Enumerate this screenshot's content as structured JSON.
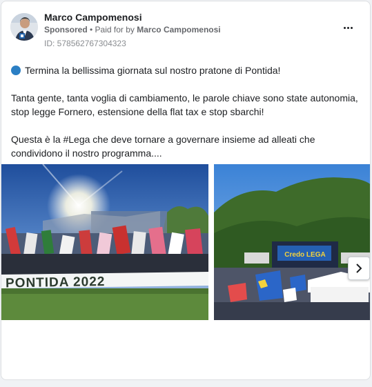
{
  "ad": {
    "advertiser_name": "Marco Campomenosi",
    "sponsored_label": "Sponsored",
    "paid_for_prefix": "• Paid for by",
    "paid_for_by": "Marco Campomenosi",
    "id_label": "ID: 578562767304323"
  },
  "post": {
    "line1": "Termina la bellissima giornata sul nostro pratone di Pontida!",
    "line2": "Tanta gente, tanta voglia di cambiamento, le parole chiave sono state autonomia, stop legge Fornero, estensione della flat tax e stop sbarchi!",
    "line3": "Questa è la #Lega che deve tornare a governare insieme ad alleati che condividono il nostro programma...."
  },
  "media": {
    "slide1_banner": "PONTIDA 2022",
    "slide2_stage_text": "Credo LEGA"
  },
  "icons": {
    "more": "more-horizontal-icon",
    "next": "chevron-right-icon",
    "bullet": "blue-circle-emoji"
  },
  "colors": {
    "accent_blue": "#2b7fc4",
    "text": "#1c1e21",
    "muted": "#65676b"
  }
}
